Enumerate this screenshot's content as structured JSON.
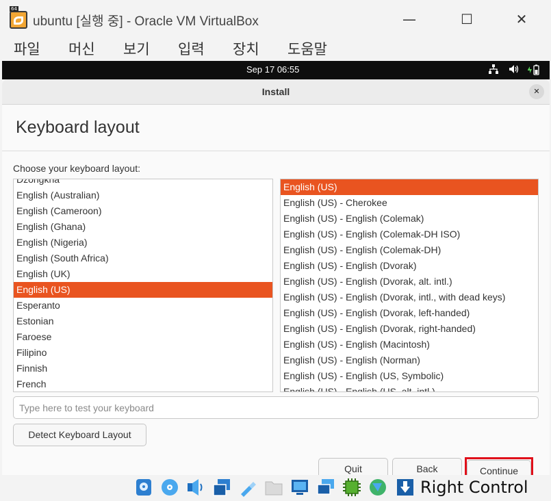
{
  "window": {
    "title": "ubuntu [실행 중] - Oracle VM VirtualBox",
    "icon_badge": "64",
    "minimize_glyph": "—",
    "maximize_glyph": "☐",
    "close_glyph": "✕"
  },
  "menubar": {
    "items": [
      "파일",
      "머신",
      "보기",
      "입력",
      "장치",
      "도움말"
    ]
  },
  "guest_topbar": {
    "clock": "Sep 17  06:55",
    "icons": [
      "network-icon",
      "volume-icon",
      "battery-icon"
    ]
  },
  "dialog": {
    "title": "Install",
    "close_glyph": "✕",
    "page_title": "Keyboard layout",
    "choose_label": "Choose your keyboard layout:",
    "layouts": [
      "Dzongkha",
      "English (Australian)",
      "English (Cameroon)",
      "English (Ghana)",
      "English (Nigeria)",
      "English (South Africa)",
      "English (UK)",
      "English (US)",
      "Esperanto",
      "Estonian",
      "Faroese",
      "Filipino",
      "Finnish",
      "French"
    ],
    "layouts_selected": "English (US)",
    "variants": [
      "English (US)",
      "English (US) - Cherokee",
      "English (US) - English (Colemak)",
      "English (US) - English (Colemak-DH ISO)",
      "English (US) - English (Colemak-DH)",
      "English (US) - English (Dvorak)",
      "English (US) - English (Dvorak, alt. intl.)",
      "English (US) - English (Dvorak, intl., with dead keys)",
      "English (US) - English (Dvorak, left-handed)",
      "English (US) - English (Dvorak, right-handed)",
      "English (US) - English (Macintosh)",
      "English (US) - English (Norman)",
      "English (US) - English (US, Symbolic)",
      "English (US) - English (US, alt. intl.)"
    ],
    "variants_selected": "English (US)",
    "test_placeholder": "Type here to test your keyboard",
    "detect_button": "Detect Keyboard Layout",
    "quit_button": "Quit",
    "back_button": "Back",
    "continue_button": "Continue",
    "accent_color": "#e95420",
    "highlight_color": "#e0101a"
  },
  "statusbar": {
    "icons": [
      "hard-disk-icon",
      "optical-drive-icon",
      "audio-icon",
      "network-adapters-icon",
      "usb-icon",
      "shared-folders-icon",
      "display-icon",
      "recording-icon",
      "cpu-icon",
      "mouse-integration-icon",
      "keyboard-host-key-icon"
    ],
    "host_key": "Right Control"
  }
}
